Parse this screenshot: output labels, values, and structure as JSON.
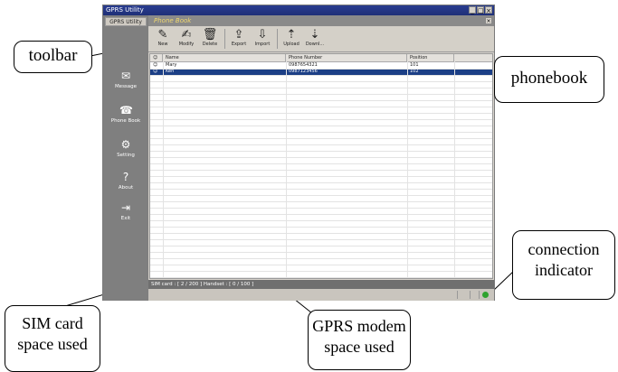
{
  "window": {
    "title": "GPRS Utility"
  },
  "nav": {
    "top_label": "GPRS Utility",
    "items": [
      {
        "label": "Message",
        "icon": "message-icon",
        "glyph": "✉"
      },
      {
        "label": "Phone Book",
        "icon": "phonebook-icon",
        "glyph": "☎"
      },
      {
        "label": "Setting",
        "icon": "setting-icon",
        "glyph": "⚙"
      },
      {
        "label": "About",
        "icon": "about-icon",
        "glyph": "?"
      },
      {
        "label": "Exit",
        "icon": "exit-icon",
        "glyph": "⇥"
      }
    ]
  },
  "panel": {
    "title": "Phone Book"
  },
  "toolbar": {
    "buttons": [
      {
        "label": "New",
        "icon": "new-icon",
        "glyph": "✎"
      },
      {
        "label": "Modify",
        "icon": "modify-icon",
        "glyph": "✍"
      },
      {
        "label": "Delete",
        "icon": "delete-icon",
        "glyph": "🗑"
      },
      {
        "label": "Export",
        "icon": "export-icon",
        "glyph": "⇪"
      },
      {
        "label": "Import",
        "icon": "import-icon",
        "glyph": "⇩"
      },
      {
        "label": "Upload",
        "icon": "upload-icon",
        "glyph": "⇡"
      },
      {
        "label": "Downl...",
        "icon": "download-icon",
        "glyph": "⇣"
      }
    ]
  },
  "table": {
    "columns": [
      "Name",
      "Phone Number",
      "Position"
    ],
    "rows": [
      {
        "name": "Mary",
        "phone": "0987654321",
        "position": "101",
        "selected": false
      },
      {
        "name": "Ken",
        "phone": "0987123456",
        "position": "102",
        "selected": true
      }
    ]
  },
  "status": {
    "text": "SIM card : [ 2 / 200 ]   Handset : [ 0 / 100 ]"
  },
  "colors": {
    "titlebar": "#1f2f78",
    "selection": "#1c3f86",
    "connected": "#2fa32f"
  },
  "callouts": {
    "toolbar": "toolbar",
    "phonebook": "phonebook",
    "connection_1": "connection",
    "connection_2": "indicator",
    "sim_1": "SIM card",
    "sim_2": "space used",
    "gprs_1": "GPRS modem",
    "gprs_2": "space used"
  }
}
